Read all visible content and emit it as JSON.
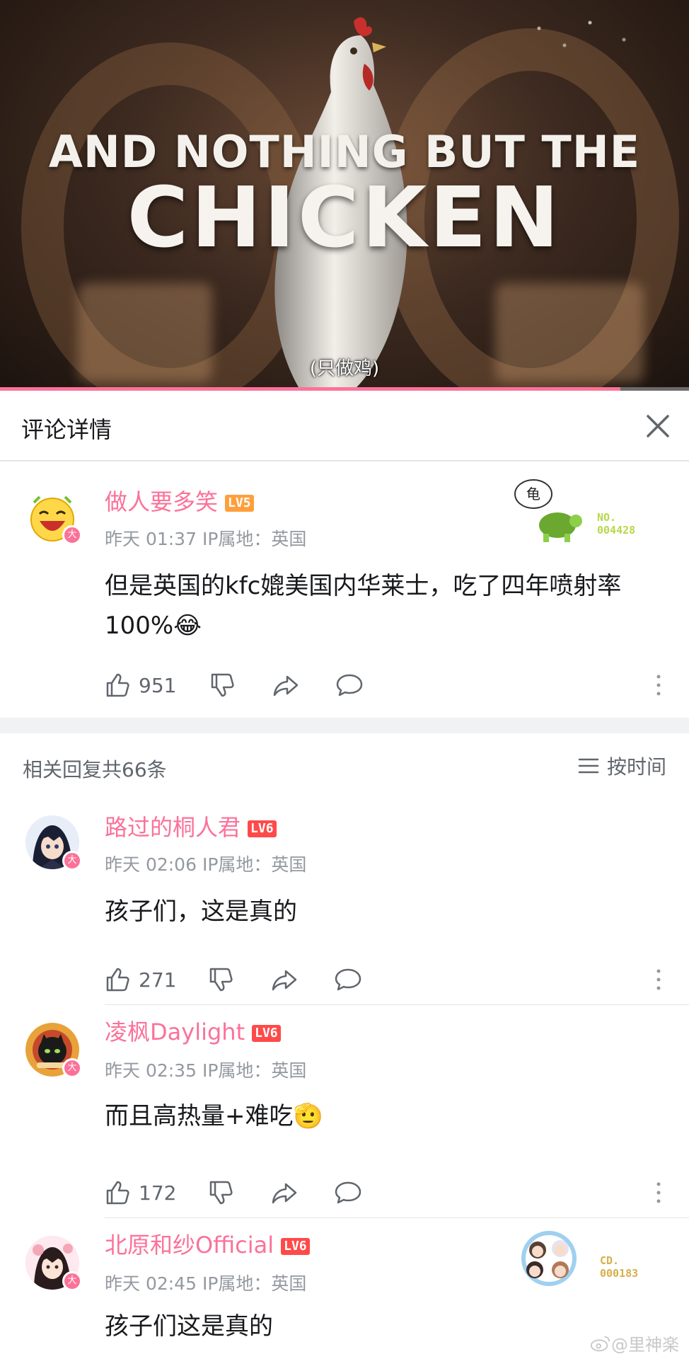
{
  "video": {
    "headline_line1": "AND NOTHING BUT THE",
    "headline_line2": "CHICKEN",
    "subtitle": "(只做鸡)",
    "progress": 0.9
  },
  "header": {
    "title": "评论详情"
  },
  "main_comment": {
    "username": "做人要多笑",
    "level": "LV5",
    "time": "昨天 01:37",
    "ip": "IP属地：英国",
    "text": "但是英国的kfc媲美国内华莱士，吃了四年喷射率100%😂",
    "likes": "951",
    "fan_badge_char": "龟",
    "fan_badge_no_label": "NO.",
    "fan_badge_no": "004428",
    "vip_badge": "大"
  },
  "replies_bar": {
    "count_text": "相关回复共66条",
    "sort_label": "按时间"
  },
  "replies": [
    {
      "username": "路过的桐人君",
      "level": "LV6",
      "time": "昨天 02:06",
      "ip": "IP属地：英国",
      "text": "孩子们，这是真的",
      "likes": "271",
      "vip_badge": "大"
    },
    {
      "username": "凌枫Daylight",
      "level": "LV6",
      "time": "昨天 02:35",
      "ip": "IP属地：英国",
      "text": "而且高热量+难吃🫡",
      "likes": "172",
      "vip_badge": "大"
    },
    {
      "username": "北原和纱Official",
      "level": "LV6",
      "time": "昨天 02:45",
      "ip": "IP属地：英国",
      "text": "孩子们这是真的",
      "vip_badge": "大",
      "fan_badge_no_label": "CD.",
      "fan_badge_no": "000183"
    }
  ],
  "watermark": "@里神楽",
  "colors": {
    "accent_pink": "#fb7299",
    "text_gray": "#9499a0",
    "lv5": "#ff9f3b",
    "lv6": "#ff4a4a"
  }
}
